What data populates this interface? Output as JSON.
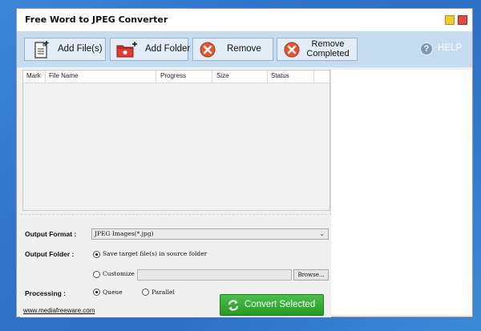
{
  "window": {
    "title": "Free Word to JPEG Converter"
  },
  "toolbar": {
    "add_files": "Add File(s)",
    "add_folder": "Add Folder",
    "remove": "Remove",
    "remove_completed_line1": "Remove",
    "remove_completed_line2": "Completed",
    "help": "HELP"
  },
  "file_list": {
    "columns": [
      "Mark",
      "File Name",
      "Progress",
      "Size",
      "Status"
    ],
    "rows": []
  },
  "options": {
    "output_format_label": "Output Format :",
    "output_format_value": "JPEG Images(*.jpg)",
    "output_folder_label": "Output Folder :",
    "save_in_source": "Save target file(s) in source folder",
    "save_in_source_selected": true,
    "customize": "Customize",
    "customize_path": "",
    "browse": "Browse...",
    "processing_label": "Processing :",
    "queue": "Queue",
    "queue_selected": true,
    "parallel": "Parallel"
  },
  "actions": {
    "convert": "Convert Selected"
  },
  "footer": {
    "link": "www.mediafreeware.com"
  },
  "icons": [
    "document-add-icon",
    "folder-add-icon",
    "remove-icon",
    "remove-completed-icon",
    "help-icon",
    "convert-icon"
  ],
  "colors": {
    "toolbar_bg": "#c6dcf0",
    "convert_green": "#2ea82e",
    "remove_orange": "#e4572e"
  }
}
